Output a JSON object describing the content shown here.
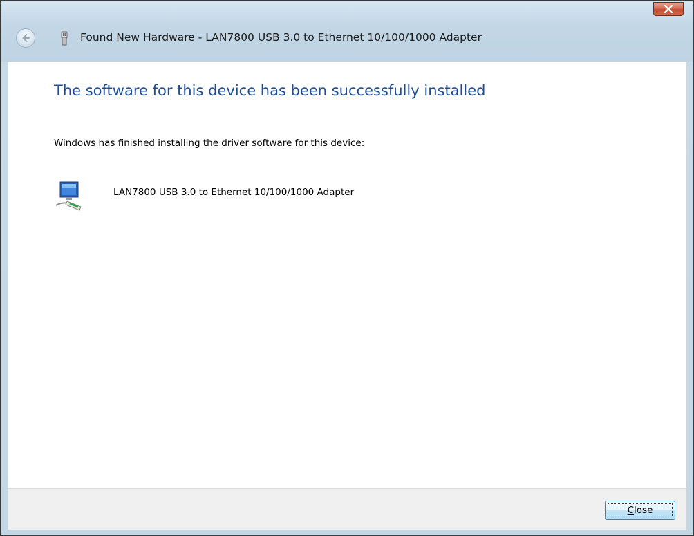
{
  "window": {
    "title": "Found New Hardware - LAN7800 USB 3.0 to Ethernet 10/100/1000 Adapter",
    "back_icon": "back-arrow-icon",
    "hardware_icon": "usb-device-icon",
    "close_icon": "close-x-icon"
  },
  "content": {
    "heading": "The software for this device has been successfully installed",
    "message": "Windows has finished installing the driver software for this device:",
    "device_name": "LAN7800 USB 3.0 to Ethernet 10/100/1000 Adapter",
    "device_icon": "network-adapter-icon"
  },
  "footer": {
    "close_button": {
      "mnemonic": "C",
      "rest": "lose"
    }
  },
  "colors": {
    "heading": "#1e4e9a",
    "close_button_red": "#c24b31",
    "footer_bg": "#f0f0f0"
  }
}
